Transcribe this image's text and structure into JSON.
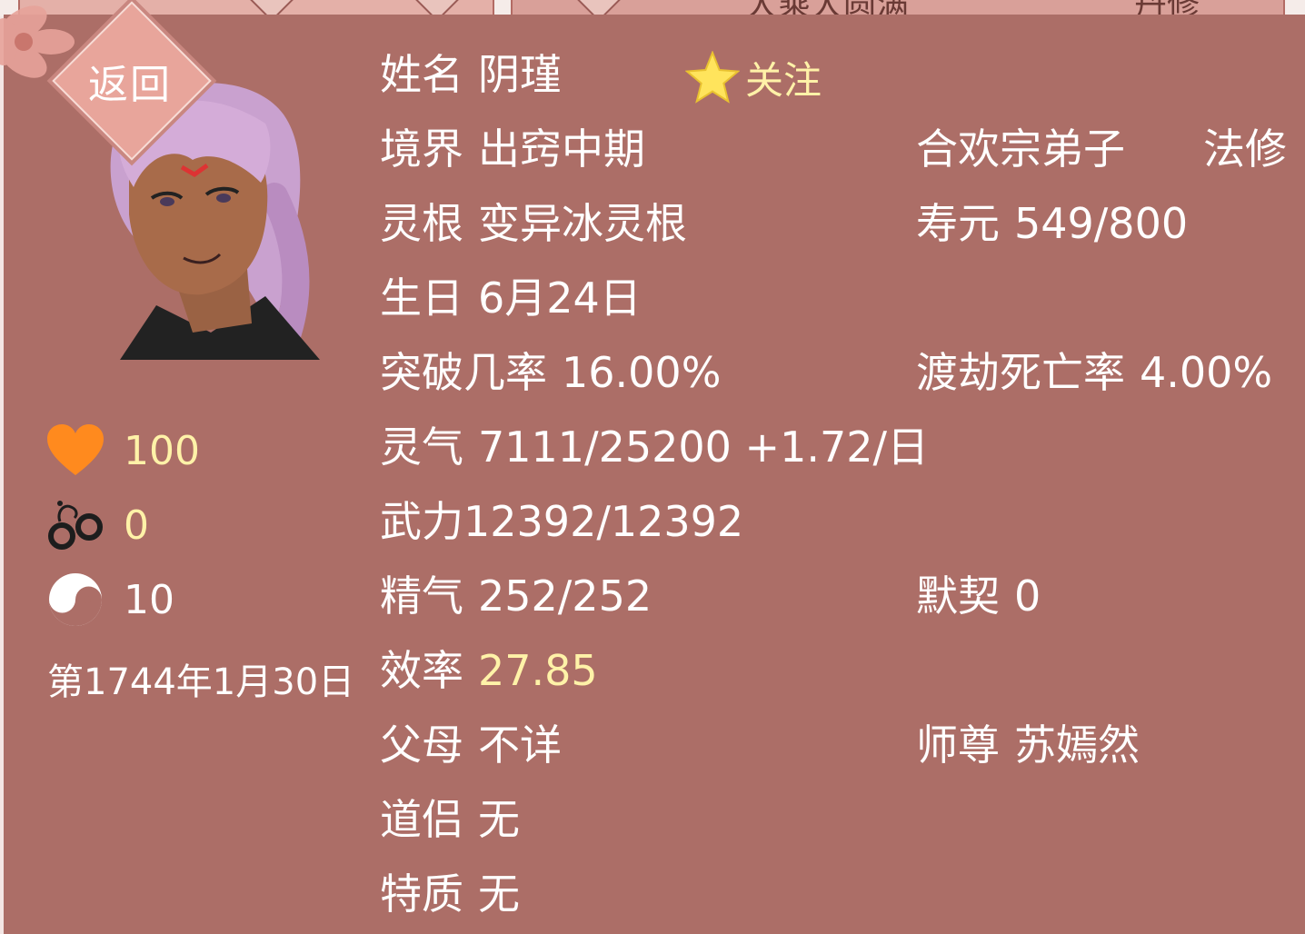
{
  "top_strip": {
    "left_text": "",
    "middle_text": "大乘大圆满",
    "right_text": "丹修"
  },
  "back_button": {
    "label": "返回"
  },
  "follow": {
    "label": "关注",
    "icon": "star-icon"
  },
  "left_stats": {
    "favor": {
      "icon": "heart-icon",
      "value": "100"
    },
    "crime": {
      "icon": "handcuffs-icon",
      "value": "0"
    },
    "yinyang": {
      "icon": "yin-yang-icon",
      "value": "10"
    }
  },
  "date": "第1744年1月30日",
  "info": {
    "name_label": "姓名",
    "name": "阴瑾",
    "realm_label": "境界",
    "realm": "出窍中期",
    "sect": "合欢宗弟子",
    "path": "法修",
    "root_label": "灵根",
    "root": "变异冰灵根",
    "life_label": "寿元",
    "life": "549/800",
    "birthday_label": "生日",
    "birthday": "6月24日",
    "breakthrough_label": "突破几率",
    "breakthrough": "16.00%",
    "tribulation_label": "渡劫死亡率",
    "tribulation": "4.00%",
    "qi_label": "灵气",
    "qi": "7111/25200 +1.72/日",
    "force_label": "武力",
    "force": "12392/12392",
    "essence_label": "精气",
    "essence": "252/252",
    "tacit_label": "默契",
    "tacit": "0",
    "efficiency_label": "效率",
    "efficiency": "27.85",
    "parents_label": "父母",
    "parents": "不详",
    "master_label": "师尊",
    "master": "苏嫣然",
    "partner_label": "道侣",
    "partner": "无",
    "trait_label": "特质",
    "trait": "无"
  },
  "colors": {
    "panel": "#ac6e67",
    "accent_yellow": "#fff2a8",
    "heart": "#ff8a1e"
  }
}
